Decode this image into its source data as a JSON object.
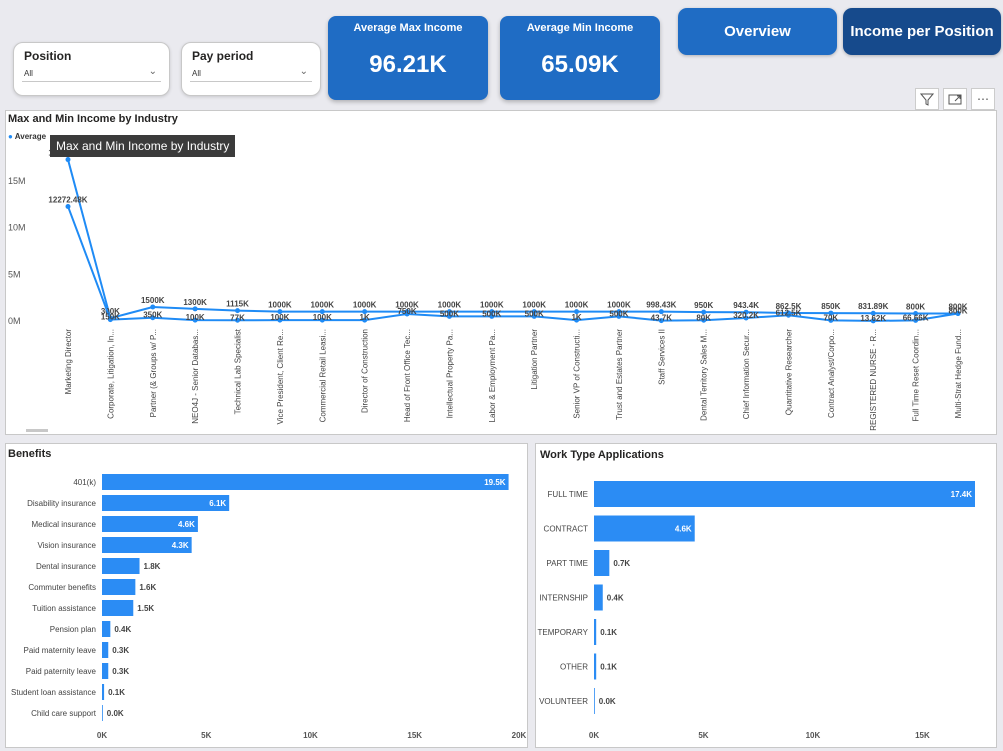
{
  "slicers": [
    {
      "title": "Position",
      "value": "All"
    },
    {
      "title": "Pay period",
      "value": "All"
    }
  ],
  "cards": [
    {
      "label": "Average Max Income",
      "value": "96.21K"
    },
    {
      "label": "Average Min Income",
      "value": "65.09K"
    }
  ],
  "nav": {
    "overview": "Overview",
    "income_per_position": "Income per Position"
  },
  "colors": {
    "accent": "#1f6cc4",
    "nav_active": "#164a8c",
    "bar": "#2b8cf4",
    "line": "#1f8bf5"
  },
  "line_chart": {
    "title": "Max and Min Income by Industry",
    "legend": "Average",
    "tooltip": "Max and Min Income by Industry",
    "yticks": [
      "15M",
      "10M",
      "5M",
      "0M"
    ]
  },
  "benefits_title": "Benefits",
  "work_title": "Work Type Applications",
  "chart_data": [
    {
      "type": "line",
      "title": "Max and Min Income by Industry",
      "categories": [
        "Marketing Director",
        "Corporate, Litigation, In...",
        "Partner (& Groups w/ P...",
        "NEO4J - Senior Databas...",
        "Technical Lab Specialist",
        "Vice President, Client Re...",
        "Commercial Retail Leasi...",
        "Director of Construction",
        "Head of Front Office Tec...",
        "Intellectual Property Pa...",
        "Labor & Employment Pa...",
        "Litigation Partner",
        "Senior VP of Constructi...",
        "Trust and Estates Partner",
        "Staff Services II",
        "Dental Territory Sales M...",
        "Chief Information Secur...",
        "Quantitative Researcher",
        "Contract Analyst/Corpo...",
        "REGISTERED NURSE - R...",
        "Full Time Reset Coordin...",
        "Multi-Strat Hedge Fund..."
      ],
      "series": [
        {
          "values": [
            17297140,
            300000,
            1500000,
            1300000,
            1115000,
            1000000,
            1000000,
            1000000,
            1000000,
            1000000,
            1000000,
            1000000,
            1000000,
            1000000,
            998430,
            950000,
            943400,
            862500,
            850000,
            831890,
            800000,
            800000
          ],
          "labels": [
            "17297.14K",
            "300K",
            "1500K",
            "1300K",
            "1115K",
            "1000K",
            "1000K",
            "1000K",
            "1000K",
            "1000K",
            "1000K",
            "1000K",
            "1000K",
            "1000K",
            "998.43K",
            "950K",
            "943.4K",
            "862.5K",
            "850K",
            "831.89K",
            "800K",
            "800K"
          ]
        },
        {
          "values": [
            12272480,
            150000,
            350000,
            100000,
            77000,
            100000,
            100000,
            100000,
            750000,
            500000,
            500000,
            500000,
            100000,
            500000,
            43700,
            80000,
            320200,
            612500,
            70000,
            13620,
            66660,
            800000
          ],
          "labels": [
            "12272.48K",
            "150K",
            "350K",
            "100K",
            "77K",
            "100K",
            "100K",
            "1K",
            "750K",
            "500K",
            "500K",
            "500K",
            "1K",
            "500K",
            "43.7K",
            "80K",
            "320.2K",
            "612.5K",
            "70K",
            "13.62K",
            "66.66K",
            "800K"
          ]
        }
      ],
      "yticks": [
        "15M",
        "10M",
        "5M",
        "0M"
      ],
      "ylim": [
        0,
        18000000
      ]
    },
    {
      "type": "bar",
      "title": "Benefits",
      "categories": [
        "401(k)",
        "Disability insurance",
        "Medical insurance",
        "Vision insurance",
        "Dental insurance",
        "Commuter benefits",
        "Tuition assistance",
        "Pension plan",
        "Paid maternity leave",
        "Paid paternity leave",
        "Student loan assistance",
        "Child care support"
      ],
      "values": [
        19500,
        6100,
        4600,
        4300,
        1800,
        1600,
        1500,
        400,
        300,
        300,
        100,
        0
      ],
      "labels": [
        "19.5K",
        "6.1K",
        "4.6K",
        "4.3K",
        "1.8K",
        "1.6K",
        "1.5K",
        "0.4K",
        "0.3K",
        "0.3K",
        "0.1K",
        "0.0K"
      ],
      "xticks": [
        "0K",
        "5K",
        "10K",
        "15K",
        "20K"
      ],
      "xlim": [
        0,
        20000
      ]
    },
    {
      "type": "bar",
      "title": "Work Type Applications",
      "categories": [
        "FULL TIME",
        "CONTRACT",
        "PART TIME",
        "INTERNSHIP",
        "TEMPORARY",
        "OTHER",
        "VOLUNTEER"
      ],
      "values": [
        17400,
        4600,
        700,
        400,
        100,
        100,
        0
      ],
      "labels": [
        "17.4K",
        "4.6K",
        "0.7K",
        "0.4K",
        "0.1K",
        "0.1K",
        "0.0K"
      ],
      "xticks": [
        "0K",
        "5K",
        "10K",
        "15K"
      ],
      "xlim": [
        0,
        17400
      ]
    }
  ]
}
